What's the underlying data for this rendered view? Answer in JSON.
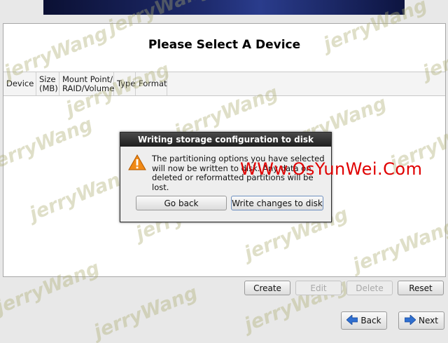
{
  "page": {
    "title": "Please Select A Device"
  },
  "table": {
    "columns": [
      "Device",
      "Size (MB)",
      "Mount Point/ RAID/Volume",
      "Type",
      "Format"
    ],
    "column_lines": [
      [
        "Device"
      ],
      [
        "Size",
        "(MB)"
      ],
      [
        "Mount Point/",
        "RAID/Volume"
      ],
      [
        "Type"
      ],
      [
        "Format"
      ]
    ]
  },
  "dialog": {
    "title": "Writing storage configuration to disk",
    "message": "The partitioning options you have selected will now be written to disk.  Any data on deleted or reformatted partitions will be lost.",
    "go_back_label": "Go back",
    "write_label": "Write changes to disk",
    "icon": "warning-icon"
  },
  "actions": {
    "create_label": "Create",
    "edit_label": "Edit",
    "delete_label": "Delete",
    "reset_label": "Reset"
  },
  "nav": {
    "back_label": "Back",
    "next_label": "Next",
    "back_icon": "arrow-left-icon",
    "next_icon": "arrow-right-icon"
  },
  "watermarks": {
    "text": "jerryWang",
    "site": "WWw.OsYunWei.Com"
  },
  "colors": {
    "dialog_title_bg": "#1e1e1e",
    "site_watermark": "#e00000",
    "arrow": "#2f6fd0"
  }
}
